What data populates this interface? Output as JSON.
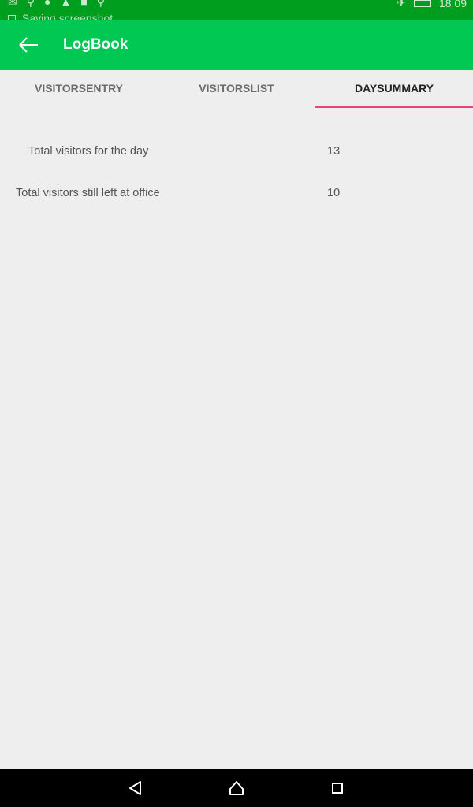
{
  "status_bar": {
    "notification_text": "Saving screenshot",
    "time": "18:09",
    "icons": [
      "gmail-icon",
      "usb-icon",
      "android-icon",
      "warning-icon",
      "lock-icon",
      "usb-icon",
      "airplane-icon",
      "battery-icon"
    ]
  },
  "app_bar": {
    "title": "LogBook",
    "back_icon": "arrow-back-icon",
    "color": "#00c853"
  },
  "tabs": {
    "items": [
      {
        "label": "VISITORSENTRY",
        "active": false
      },
      {
        "label": "VISITORSLIST",
        "active": false
      },
      {
        "label": "DAYSUMMARY",
        "active": true
      }
    ],
    "indicator_color": "#ec407a"
  },
  "summary": {
    "rows": [
      {
        "label": "Total visitors for the day",
        "value": "13"
      },
      {
        "label": "Total visitors still left at office",
        "value": "10"
      }
    ]
  },
  "nav_bar": {
    "buttons": [
      "back-triangle-icon",
      "home-icon",
      "recents-square-icon"
    ]
  }
}
